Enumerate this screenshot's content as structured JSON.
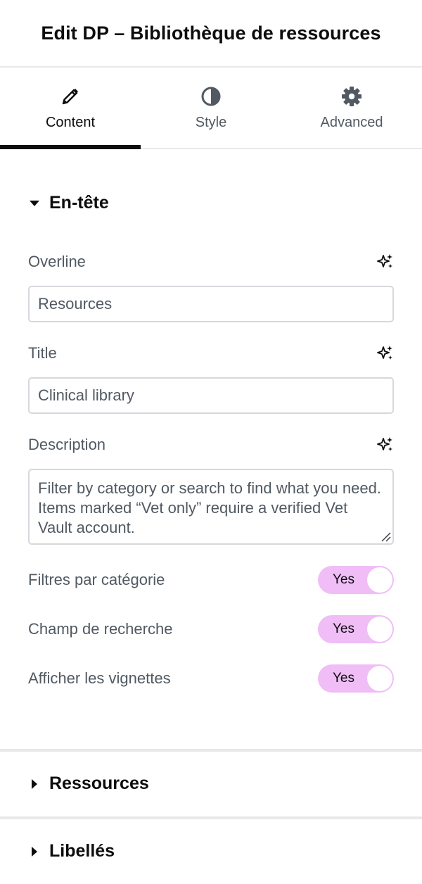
{
  "header": {
    "title": "Edit DP – Bibliothèque de ressources"
  },
  "tabs": [
    {
      "label": "Content",
      "icon": "pencil-icon",
      "active": true
    },
    {
      "label": "Style",
      "icon": "contrast-icon",
      "active": false
    },
    {
      "label": "Advanced",
      "icon": "gear-icon",
      "active": false
    }
  ],
  "sections": {
    "header_section": {
      "title": "En-tête",
      "expanded": true,
      "fields": {
        "overline": {
          "label": "Overline",
          "value": "Resources"
        },
        "title": {
          "label": "Title",
          "value": "Clinical library"
        },
        "description": {
          "label": "Description",
          "value": "Filter by category or search to find what you need. Items marked “Vet only” require a verified Vet Vault account."
        }
      },
      "toggles": [
        {
          "label": "Filtres par catégorie",
          "state": "Yes"
        },
        {
          "label": "Champ de recherche",
          "state": "Yes"
        },
        {
          "label": "Afficher les vignettes",
          "state": "Yes"
        }
      ]
    },
    "resources": {
      "title": "Ressources",
      "expanded": false
    },
    "labels": {
      "title": "Libellés",
      "expanded": false
    }
  },
  "colors": {
    "toggle_on": "#f0bdf7",
    "active_tab_indicator": "#0c0d0e",
    "border": "#d5d8dc"
  }
}
